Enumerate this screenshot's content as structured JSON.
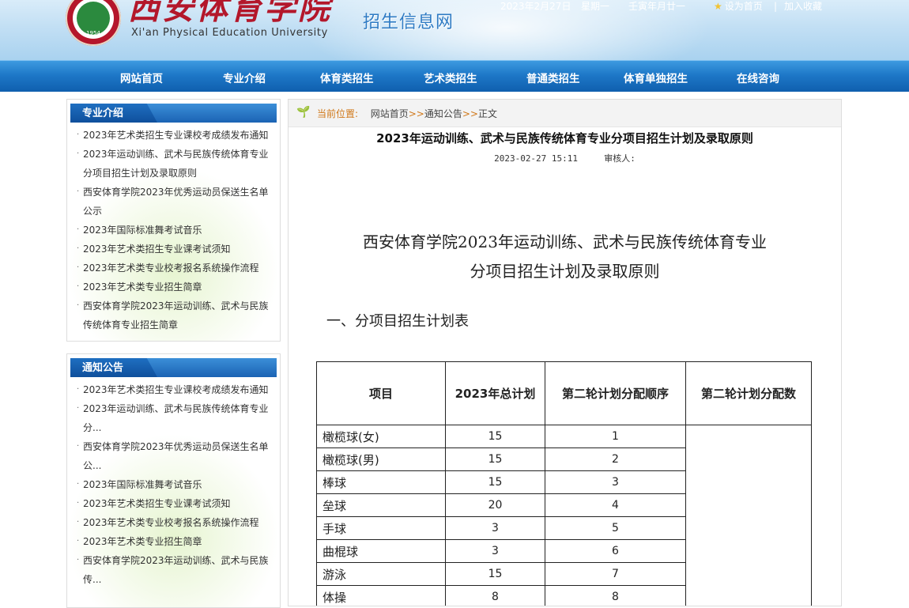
{
  "header": {
    "logo_year": "1954",
    "logo_cn": "西安体育学院",
    "logo_en": "Xi'an Physical Education University",
    "site_title": "招生信息网",
    "date": "2023年2月27日",
    "weekday": "星期一",
    "lunar": "壬寅年月廿一",
    "set_home": "设为首页",
    "separator": "|",
    "favorite": "加入收藏"
  },
  "nav": [
    "网站首页",
    "专业介绍",
    "体育类招生",
    "艺术类招生",
    "普通类招生",
    "体育单独招生",
    "在线咨询"
  ],
  "sidebar": {
    "box1": {
      "title": "专业介绍",
      "items": [
        "2023年艺术类招生专业课校考成绩发布通知",
        "2023年运动训练、武术与民族传统体育专业分项目招生计划及录取原则",
        "西安体育学院2023年优秀运动员保送生名单公示",
        "2023年国际标准舞考试音乐",
        "2023年艺术类招生专业课考试须知",
        "2023年艺术类专业校考报名系统操作流程",
        "2023年艺术类专业招生简章",
        "西安体育学院2023年运动训练、武术与民族传统体育专业招生简章"
      ]
    },
    "box2": {
      "title": "通知公告",
      "items": [
        "2023年艺术类招生专业课校考成绩发布通知",
        "2023年运动训练、武术与民族传统体育专业分...",
        "西安体育学院2023年优秀运动员保送生名单公...",
        "2023年国际标准舞考试音乐",
        "2023年艺术类招生专业课考试须知",
        "2023年艺术类专业校考报名系统操作流程",
        "2023年艺术类专业招生简章",
        "西安体育学院2023年运动训练、武术与民族传..."
      ]
    }
  },
  "breadcrumb": {
    "label": "当前位置:",
    "home": "网站首页",
    "arrow": ">>",
    "section": "通知公告",
    "current": "正文"
  },
  "article": {
    "title": "2023年运动训练、武术与民族传统体育专业分项目招生计划及录取原则",
    "datetime": "2023-02-27 15:11",
    "reviewer_label": "审核人:",
    "heading_line1": "西安体育学院2023年运动训练、武术与民族传统体育专业",
    "heading_line2": "分项目招生计划及录取原则",
    "section1": "一、分项目招生计划表"
  },
  "table": {
    "headers": [
      "项目",
      "2023年总计划",
      "第二轮计划分配顺序",
      "第二轮计划分配数"
    ],
    "rows": [
      {
        "name": "橄榄球(女)",
        "total": "15",
        "order": "1"
      },
      {
        "name": "橄榄球(男)",
        "total": "15",
        "order": "2"
      },
      {
        "name": "棒球",
        "total": "15",
        "order": "3"
      },
      {
        "name": "垒球",
        "total": "20",
        "order": "4"
      },
      {
        "name": "手球",
        "total": "3",
        "order": "5"
      },
      {
        "name": "曲棍球",
        "total": "3",
        "order": "6"
      },
      {
        "name": "游泳",
        "total": "15",
        "order": "7"
      },
      {
        "name": "体操",
        "total": "8",
        "order": "8"
      }
    ]
  },
  "colors": {
    "nav_blue": "#1e78c8",
    "brand_red": "#b3172b",
    "crumb_orange": "#d0781a"
  }
}
